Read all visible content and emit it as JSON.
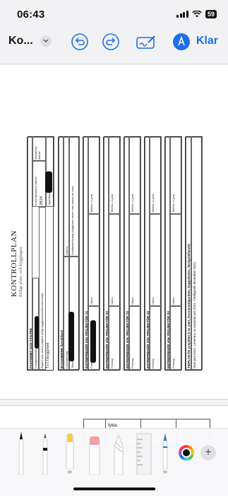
{
  "status_bar": {
    "time": "06:43",
    "battery": "59"
  },
  "toolbar": {
    "document_title": "Ko...",
    "done_label": "Klar"
  },
  "document": {
    "title": "KONTROLLPLAN",
    "subtitle": "Enligt plan- och bygglagen",
    "sections": {
      "fastighet": {
        "header": "FASTIGHET OCH ÅTGÄRD",
        "fastighetsbeteckning": "Fastighetsbeteckning",
        "atgard": "Åtgärd som avses (åtgärd enligt byggloveansökan/anmälan)",
        "atgard_value": "Tillbyggnad",
        "kontrollplan_datum": "Kontrollplanens datum:",
        "kontrollplan_datum_value": "2024",
        "reviderad": "Reviderad datum:",
        "upprattad_av": "Upprättad av:"
      },
      "byggherre": {
        "header": "BYGGHERRE (beställare)",
        "namn": "Namn/företag",
        "adress": "Adress",
        "telefon": "Telefon, e-post",
        "kvalitetsansvarig": "Kvalitetsansvarig (byggherre anser som annan än mer)"
      },
      "entreprenorer": [
        {
          "header": "ENTREPRENÖR eller PROJEKTÖR (1)",
          "foretag": "Företag",
          "namn": "Namn",
          "telefon": "Telefon, e-post"
        },
        {
          "header": "ENTREPRENÖR eller PROJEKTÖR (2)",
          "foretag": "Företag",
          "namn": "Namn",
          "telefon": "Telefon, e-post"
        },
        {
          "header": "ENTREPRENÖR eller PROJEKTÖR (3)",
          "foretag": "Företag",
          "namn": "Namn",
          "telefon": "Telefon, e-post"
        },
        {
          "header": "ENTREPRENÖR eller PROJEKTÖR (4)",
          "foretag": "Företag",
          "namn": "Namn",
          "telefon": "Telefon, e-post"
        },
        {
          "header": "ENTREPRENÖR eller PROJEKTÖR (5)",
          "foretag": "Företag",
          "namn": "Namn",
          "telefon": "Telefon, e-post"
        }
      ],
      "tidplan": {
        "header": "TIDPLAN för projektet (t ex start, leveranstidpunkter, byggskeden, färdigställande)",
        "text": "Start juni 2024. Leverans av material juni 2024. Färdigställt december 2024."
      }
    }
  },
  "page2": {
    "text": "fylda"
  },
  "markup_tools": {
    "marker_label": "80",
    "pen_label": "50"
  }
}
